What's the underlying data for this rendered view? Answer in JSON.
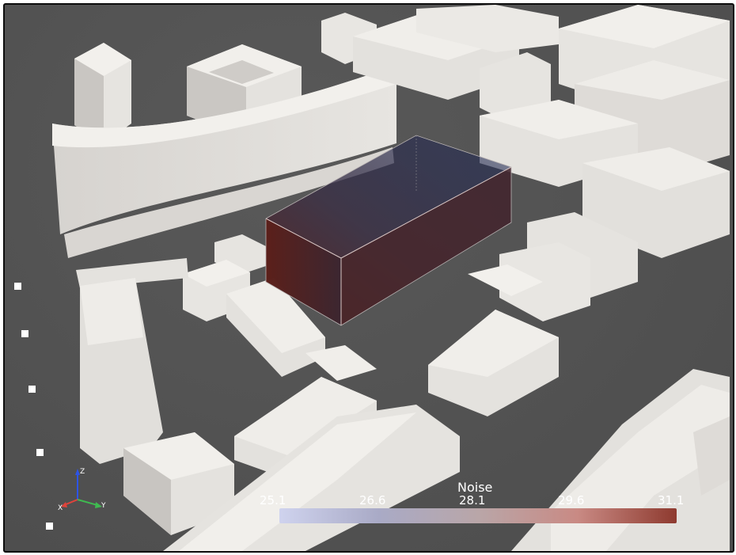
{
  "viewport": {
    "background": "#505050",
    "building_color": "#eceae6"
  },
  "legend": {
    "title": "Noise",
    "ticks": [
      "25.1",
      "26.6",
      "28.1",
      "29.6",
      "31.1"
    ],
    "colors": [
      "#cfd3ee",
      "#a9aac6",
      "#b9a6a8",
      "#c98a84",
      "#8e3a2f"
    ]
  },
  "orientation_axes": {
    "x_label": "X",
    "y_label": "Y",
    "z_label": "Z",
    "x_color": "#e0433b",
    "y_color": "#3fb950",
    "z_color": "#2d54e6"
  },
  "markers": [
    {
      "name": "marker-1"
    },
    {
      "name": "marker-2"
    },
    {
      "name": "marker-3"
    },
    {
      "name": "marker-4"
    },
    {
      "name": "marker-5"
    }
  ],
  "volume": {
    "label": "noise-volume",
    "color_low": "#1e2a55",
    "color_high": "#5e1a17"
  }
}
